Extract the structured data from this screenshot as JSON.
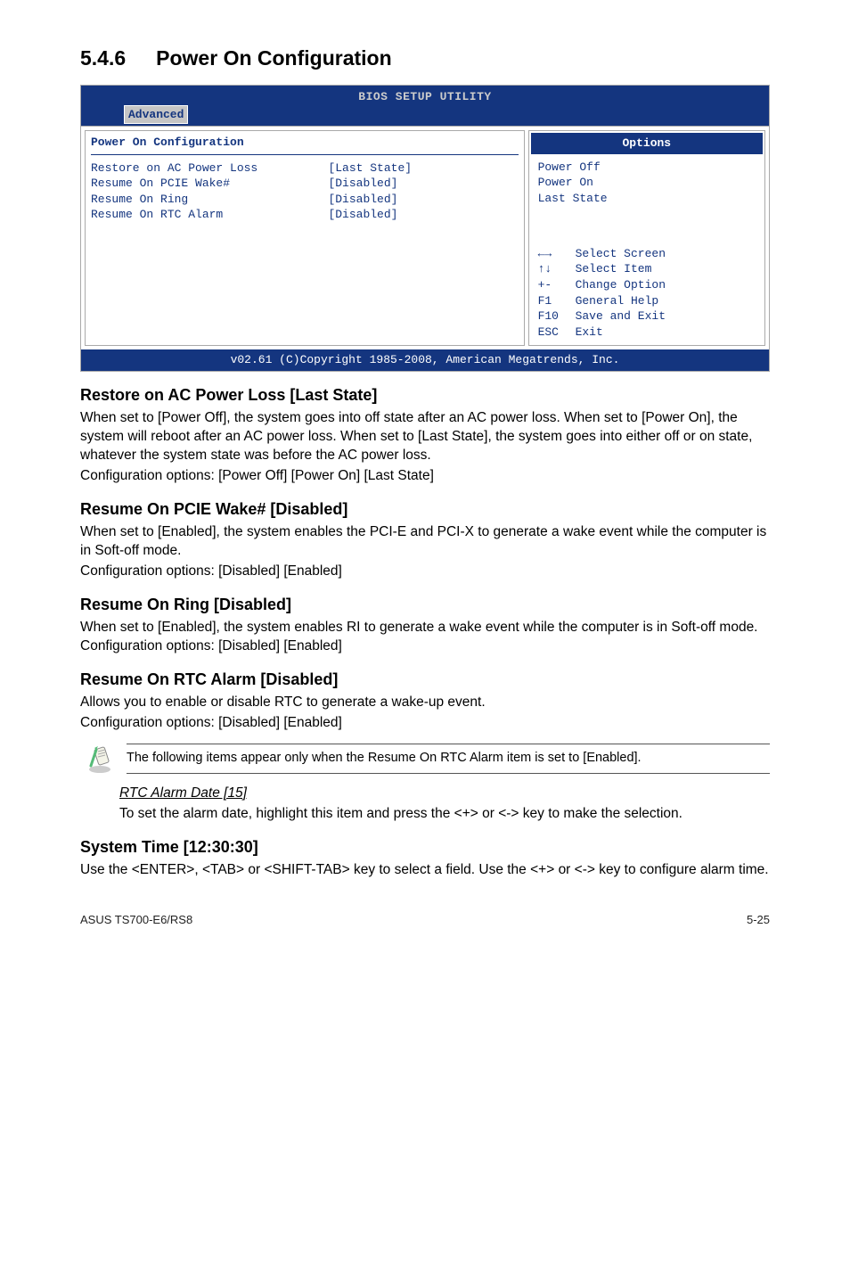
{
  "section": {
    "number": "5.4.6",
    "title": "Power On Configuration"
  },
  "bios": {
    "utility": "BIOS SETUP UTILITY",
    "tab": "Advanced",
    "left_title": "Power On Configuration",
    "rows": [
      {
        "label": "Restore on AC Power Loss",
        "value": "[Last State]"
      },
      {
        "label": "",
        "value": ""
      },
      {
        "label": "Resume On PCIE Wake#",
        "value": "[Disabled]"
      },
      {
        "label": "Resume On Ring",
        "value": "[Disabled]"
      },
      {
        "label": "Resume On RTC Alarm",
        "value": "[Disabled]"
      }
    ],
    "options_header": "Options",
    "options": [
      "Power Off",
      "Power On",
      "Last State"
    ],
    "nav": [
      {
        "key": "←→",
        "desc": "Select Screen"
      },
      {
        "key": "↑↓",
        "desc": "Select Item"
      },
      {
        "key": "+-",
        "desc": "Change Option"
      },
      {
        "key": "F1",
        "desc": "General Help"
      },
      {
        "key": "F10",
        "desc": "Save and Exit"
      },
      {
        "key": "ESC",
        "desc": "Exit"
      }
    ],
    "footer": "v02.61 (C)Copyright 1985-2008, American Megatrends, Inc."
  },
  "items": {
    "restore": {
      "heading": "Restore on AC Power Loss [Last State]",
      "p1": "When set to [Power Off], the system goes into off state after an AC power loss. When set to [Power On], the system will reboot after an AC power loss. When set to [Last State], the system goes into either off or on state, whatever the system state was before the AC power loss.",
      "p2": "Configuration options: [Power Off] [Power On] [Last State]"
    },
    "pcie": {
      "heading": "Resume On PCIE Wake# [Disabled]",
      "p1": "When set to [Enabled], the system enables the PCI-E and PCI-X to generate a wake event while the computer is in Soft-off mode.",
      "p2": "Configuration options: [Disabled] [Enabled]"
    },
    "ring": {
      "heading": "Resume On Ring [Disabled]",
      "p1": "When set to [Enabled], the system enables RI to generate a wake event while the computer is in Soft-off mode. Configuration options: [Disabled] [Enabled]"
    },
    "rtc": {
      "heading": "Resume On RTC Alarm [Disabled]",
      "p1": "Allows you to enable or disable RTC to generate a wake-up event.",
      "p2": "Configuration options: [Disabled] [Enabled]"
    },
    "note": "The following items appear only when the Resume On RTC Alarm item is set to [Enabled].",
    "rtc_date": {
      "name": "RTC Alarm Date [15]",
      "p": "To set the alarm date, highlight this item and press the <+> or <-> key to make the selection."
    },
    "systime": {
      "heading": "System Time [12:30:30]",
      "p": "Use the <ENTER>, <TAB> or <SHIFT-TAB> key to select a field. Use the <+> or <-> key to configure alarm time."
    }
  },
  "footer": {
    "left": "ASUS TS700-E6/RS8",
    "right": "5-25"
  }
}
